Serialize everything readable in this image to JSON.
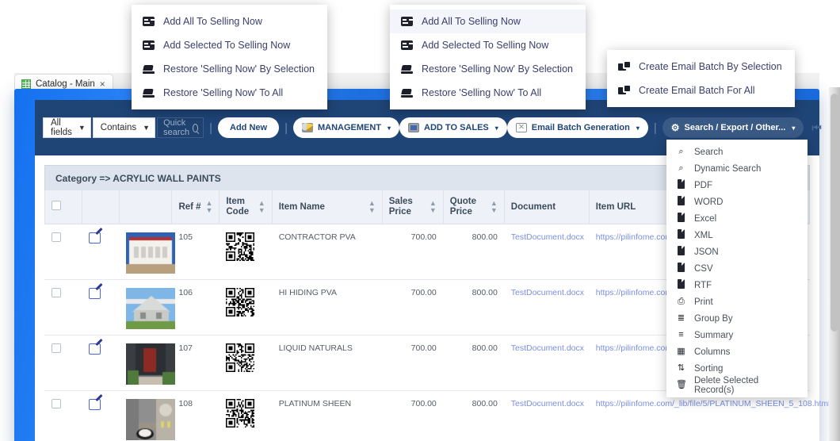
{
  "tab": {
    "title": "Catalog - Main",
    "close": "×",
    "icon": "grid-icon"
  },
  "toolbar": {
    "field_select": "All fields",
    "operator_select": "Contains",
    "search_placeholder": "Quick search",
    "search_value": "",
    "add_new": "Add New",
    "management": "MANAGEMENT",
    "add_to_sales": "ADD TO SALES",
    "email_batch": "Email Batch Generation",
    "search_export": "Search / Export / Other...",
    "caret": "▾",
    "divider": "|",
    "nav_first": "⏮"
  },
  "grid": {
    "category_label": "Category => ACRYLIC WALL PAINTS",
    "columns": [
      {
        "label": "",
        "sortable": false
      },
      {
        "label": "",
        "sortable": false
      },
      {
        "label": "",
        "sortable": false
      },
      {
        "label": "Ref #",
        "sortable": true
      },
      {
        "label": "Item Code",
        "sortable": true
      },
      {
        "label": "Item Name",
        "sortable": true
      },
      {
        "label": "Sales Price",
        "sortable": true
      },
      {
        "label": "Quote Price",
        "sortable": true
      },
      {
        "label": "Document",
        "sortable": false
      },
      {
        "label": "Item URL",
        "sortable": false
      }
    ],
    "rows": [
      {
        "ref": "105",
        "name": "CONTRACTOR PVA",
        "sales": "700.00",
        "quote": "800.00",
        "document": "TestDocument.docx",
        "url": "https://pilinfome.com/_"
      },
      {
        "ref": "106",
        "name": "HI HIDING PVA",
        "sales": "700.00",
        "quote": "800.00",
        "document": "TestDocument.docx",
        "url": "https://pilinfome.com/_"
      },
      {
        "ref": "107",
        "name": "LIQUID NATURALS",
        "sales": "700.00",
        "quote": "800.00",
        "document": "TestDocument.docx",
        "url": "https://pilinfome.com/_"
      },
      {
        "ref": "108",
        "name": "PLATINUM SHEEN",
        "sales": "700.00",
        "quote": "800.00",
        "document": "TestDocument.docx",
        "url": "https://pilinfome.com/_lib/file/5/PLATINUM_SHEEN_5_108.html"
      }
    ]
  },
  "menu_sales_back": {
    "items": [
      {
        "label": "Add All To Selling Now",
        "icon": "card-icon"
      },
      {
        "label": "Add Selected To Selling Now",
        "icon": "card-icon"
      },
      {
        "label": "Restore 'Selling Now' By Selection",
        "icon": "eraser-icon"
      },
      {
        "label": "Restore 'Selling Now' To All",
        "icon": "eraser-icon"
      }
    ]
  },
  "menu_sales_front": {
    "items": [
      {
        "label": "Add All To Selling Now",
        "icon": "card-icon",
        "highlighted": true
      },
      {
        "label": "Add Selected To Selling Now",
        "icon": "card-icon"
      },
      {
        "label": "Restore 'Selling Now' By Selection",
        "icon": "eraser-icon"
      },
      {
        "label": "Restore 'Selling Now' To All",
        "icon": "eraser-icon"
      }
    ]
  },
  "menu_email": {
    "items": [
      {
        "label": "Create Email Batch By Selection",
        "icon": "email-batch-icon"
      },
      {
        "label": "Create Email Batch For All",
        "icon": "email-batch-icon"
      }
    ]
  },
  "menu_search_export": {
    "items": [
      {
        "label": "Search",
        "icon": "search-icon"
      },
      {
        "label": "Dynamic Search",
        "icon": "search-icon"
      },
      {
        "label": "PDF",
        "icon": "document-icon"
      },
      {
        "label": "WORD",
        "icon": "document-icon"
      },
      {
        "label": "Excel",
        "icon": "document-icon"
      },
      {
        "label": "XML",
        "icon": "document-icon"
      },
      {
        "label": "JSON",
        "icon": "document-icon"
      },
      {
        "label": "CSV",
        "icon": "document-icon"
      },
      {
        "label": "RTF",
        "icon": "document-icon"
      },
      {
        "label": "Print",
        "icon": "printer-icon"
      },
      {
        "label": "Group By",
        "icon": "layers-icon"
      },
      {
        "label": "Summary",
        "icon": "list-icon"
      },
      {
        "label": "Columns",
        "icon": "columns-icon"
      },
      {
        "label": "Sorting",
        "icon": "sorting-icon"
      },
      {
        "label": "Delete Selected Record(s)",
        "icon": "trash-icon"
      }
    ]
  },
  "colors": {
    "toolbar_bg": "#1f4476",
    "frame_blue": "#1d6fe0",
    "link": "#7b8fe0",
    "header_bg": "#eef2f8",
    "category_bg": "#dde4ed"
  }
}
